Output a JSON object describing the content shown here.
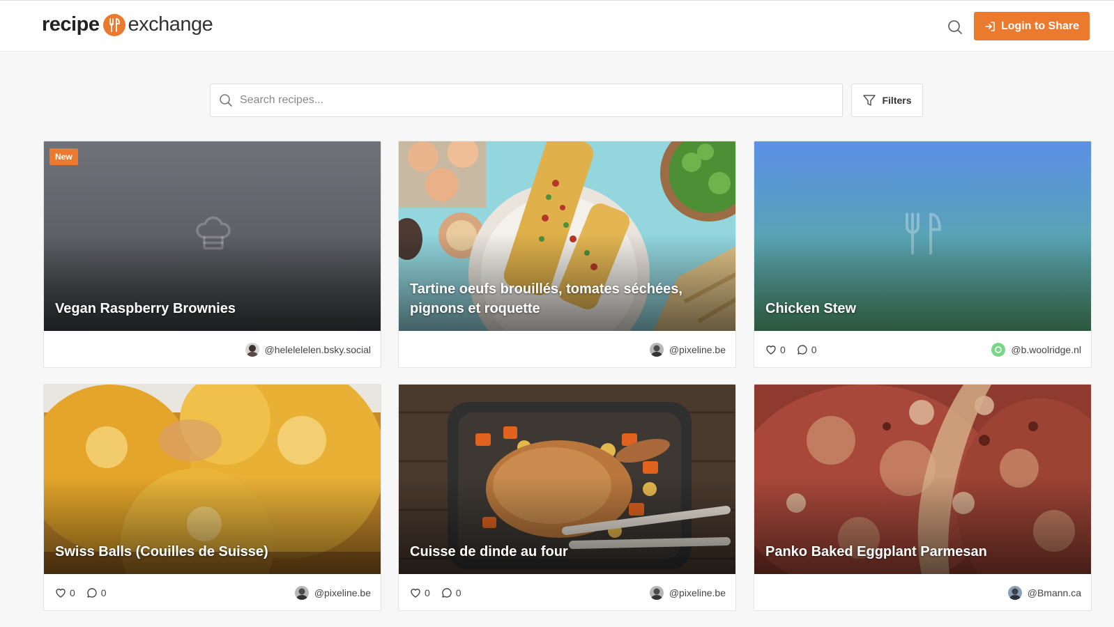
{
  "header": {
    "logo_word1": "recipe",
    "logo_word2": "exchange",
    "search_icon": "search-icon",
    "login_label": "Login to Share",
    "login_icon": "login-icon"
  },
  "search": {
    "placeholder": "Search recipes...",
    "value": "",
    "filters_label": "Filters"
  },
  "colors": {
    "accent": "#ec7a2e",
    "background": "#f7f7f7"
  },
  "recipes": [
    {
      "title": "Vegan Raspberry Brownies",
      "badge": "New",
      "author": "@helelelelen.bsky.social",
      "placeholder_icon": "chef-hat-icon"
    },
    {
      "title": "Tartine oeufs brouillés, tomates séchées, pignons et roquette",
      "author": "@pixeline.be"
    },
    {
      "title": "Chicken Stew",
      "likes": "0",
      "comments": "0",
      "author": "@b.woolridge.nl",
      "placeholder_icon": "utensils-icon"
    },
    {
      "title": "Swiss Balls (Couilles de Suisse)",
      "likes": "0",
      "comments": "0",
      "author": "@pixeline.be"
    },
    {
      "title": "Cuisse de dinde au four",
      "likes": "0",
      "comments": "0",
      "author": "@pixeline.be"
    },
    {
      "title": "Panko Baked Eggplant Parmesan",
      "author": "@Bmann.ca"
    }
  ]
}
